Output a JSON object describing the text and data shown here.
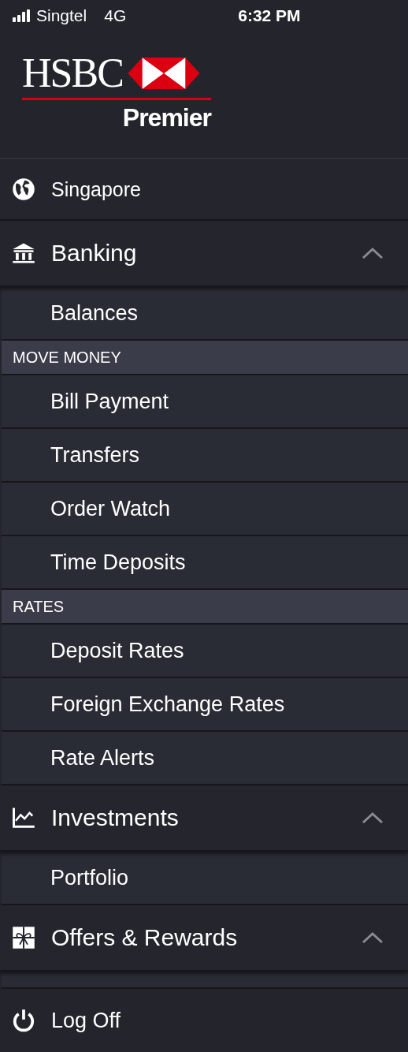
{
  "status_bar": {
    "carrier": "Singtel",
    "network": "4G",
    "time": "6:32 PM"
  },
  "logo": {
    "wordmark": "HSBC",
    "tier": "Premier"
  },
  "menu": [
    {
      "kind": "region",
      "label": "Singapore"
    },
    {
      "kind": "group",
      "label": "Banking",
      "expanded": true,
      "children": [
        {
          "kind": "item",
          "label": "Balances"
        },
        {
          "kind": "header",
          "label": "MOVE MONEY"
        },
        {
          "kind": "item",
          "label": "Bill Payment"
        },
        {
          "kind": "item",
          "label": "Transfers"
        },
        {
          "kind": "item",
          "label": "Order Watch"
        },
        {
          "kind": "item",
          "label": "Time Deposits"
        },
        {
          "kind": "header",
          "label": "RATES"
        },
        {
          "kind": "item",
          "label": "Deposit Rates"
        },
        {
          "kind": "item",
          "label": "Foreign Exchange Rates"
        },
        {
          "kind": "item",
          "label": "Rate Alerts"
        }
      ]
    },
    {
      "kind": "group",
      "label": "Investments",
      "expanded": true,
      "children": [
        {
          "kind": "item",
          "label": "Portfolio"
        }
      ]
    },
    {
      "kind": "group",
      "label": "Offers & Rewards",
      "expanded": true
    }
  ],
  "footer": {
    "label": "Log Off"
  }
}
